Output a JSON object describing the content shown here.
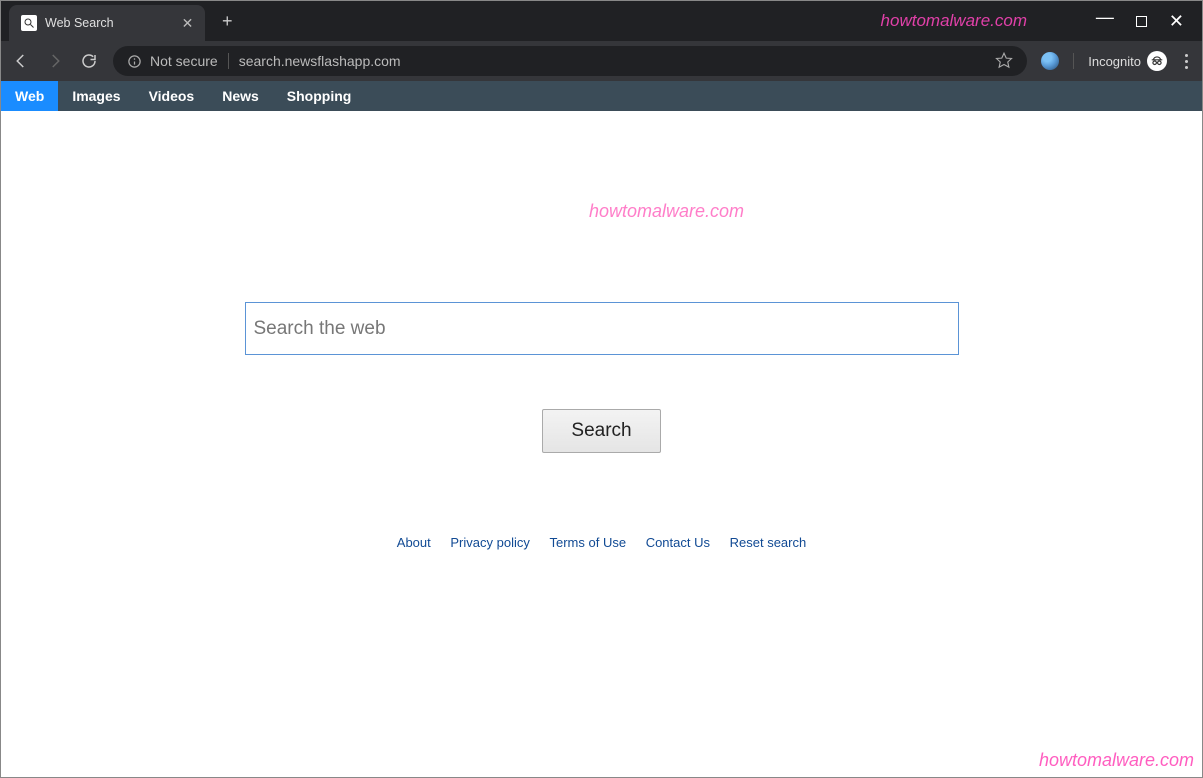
{
  "colors": {
    "accent": "#1a8cff",
    "link": "#114a94",
    "watermark": "#ff5ec0"
  },
  "watermark": "howtomalware.com",
  "window": {
    "tab_title": "Web Search"
  },
  "addressbar": {
    "security_label": "Not secure",
    "url": "search.newsflashapp.com",
    "incognito_label": "Incognito"
  },
  "nav": {
    "items": [
      {
        "label": "Web",
        "active": true
      },
      {
        "label": "Images",
        "active": false
      },
      {
        "label": "Videos",
        "active": false
      },
      {
        "label": "News",
        "active": false
      },
      {
        "label": "Shopping",
        "active": false
      }
    ]
  },
  "search": {
    "placeholder": "Search the web",
    "value": "",
    "button_label": "Search"
  },
  "footer": {
    "links": [
      {
        "label": "About"
      },
      {
        "label": "Privacy policy"
      },
      {
        "label": "Terms of Use"
      },
      {
        "label": "Contact Us"
      },
      {
        "label": "Reset search"
      }
    ]
  }
}
